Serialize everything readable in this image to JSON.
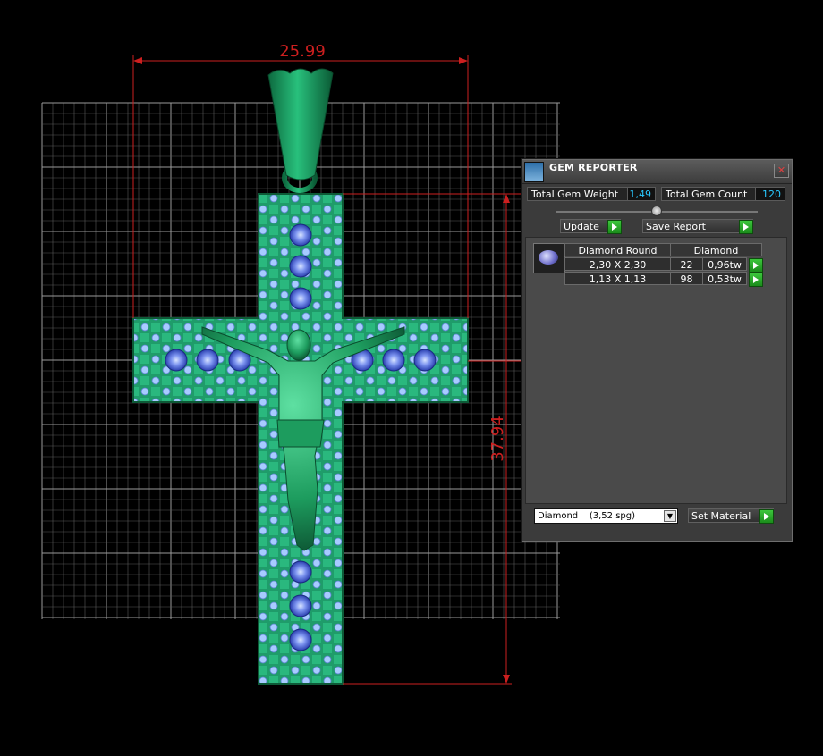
{
  "dimensions": {
    "width_label": "25.99",
    "height_label": "37.94"
  },
  "colors": {
    "dimension": "#cc1f1f",
    "grid": "#7a7a7a",
    "metal": "#1aa86a",
    "gem_light": "#9cc7ff",
    "gem_center": "#4b63d8"
  },
  "gem_reporter": {
    "title": "GEM REPORTER",
    "close_symbol": "✕",
    "total_weight_label": "Total Gem Weight",
    "total_weight_value": "1,49",
    "total_count_label": "Total Gem Count",
    "total_count_value": "120",
    "update_label": "Update",
    "save_report_label": "Save Report",
    "table": {
      "col_shape": "Diamond Round",
      "col_material": "Diamond",
      "rows": [
        {
          "size": "2,30 X 2,30",
          "count": "22",
          "weight": "0,96tw"
        },
        {
          "size": "1,13 X 1,13",
          "count": "98",
          "weight": "0,53tw"
        }
      ]
    },
    "material_select": "Diamond    (3,52 spg)",
    "set_material_label": "Set Material"
  }
}
